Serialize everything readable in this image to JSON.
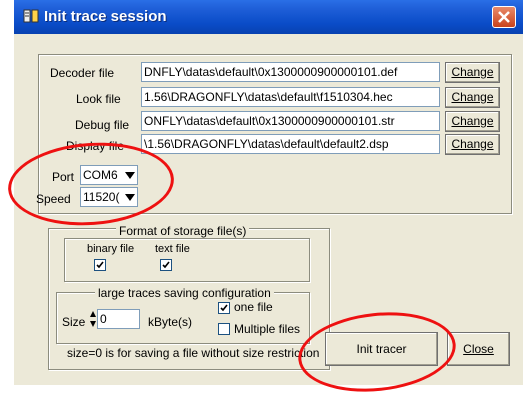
{
  "window": {
    "title": "Init trace session"
  },
  "files": [
    {
      "label": "Decoder file",
      "value": "DNFLY\\datas\\default\\0x1300000900000101.def",
      "button": "Change"
    },
    {
      "label": "Look file",
      "value": "1.56\\DRAGONFLY\\datas\\default\\f1510304.hec",
      "button": "Change"
    },
    {
      "label": "Debug file",
      "value": "ONFLY\\datas\\default\\0x1300000900000101.str",
      "button": "Change"
    },
    {
      "label": "Display file",
      "value": "\\1.56\\DRAGONFLY\\datas\\default\\default2.dsp",
      "button": "Change"
    }
  ],
  "port": {
    "label": "Port",
    "value": "COM6"
  },
  "speed": {
    "label": "Speed",
    "value": "11520("
  },
  "storage": {
    "title": "Format of storage file(s)",
    "binary_label": "binary file",
    "text_label": "text file",
    "binary_checked": true,
    "text_checked": true
  },
  "large": {
    "title": "large traces saving configuration",
    "size_label": "Size",
    "size_value": "0",
    "unit_label": "kByte(s)",
    "one_file_label": "one file",
    "multiple_files_label": "Multiple files",
    "one_file_checked": true,
    "multiple_files_checked": false,
    "note": "size=0 is for saving a file without size restriction"
  },
  "buttons": {
    "init": "Init tracer",
    "close": "Close"
  },
  "colors": {
    "titlebar": "#0a4cc8",
    "annotation": "#ee1111",
    "face": "#ece9d8"
  }
}
